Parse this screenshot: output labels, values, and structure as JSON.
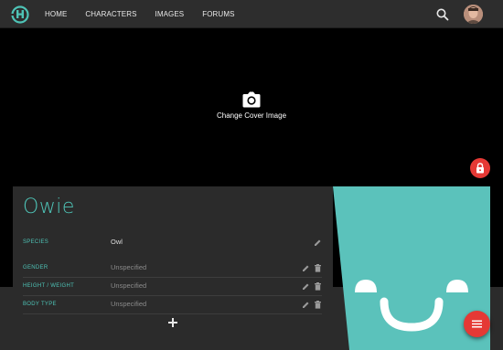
{
  "nav": {
    "items": [
      {
        "label": "HOME"
      },
      {
        "label": "CHARACTERS"
      },
      {
        "label": "IMAGES"
      },
      {
        "label": "FORUMS"
      }
    ],
    "logo_icon": "toyhouse-logo-icon",
    "search_icon": "search-icon"
  },
  "cover": {
    "change_label": "Change Cover Image",
    "camera_icon": "camera-icon",
    "lock_icon": "lock-icon"
  },
  "profile": {
    "name": "Owie",
    "fields": [
      {
        "label": "SPECIES",
        "value": "Owl"
      },
      {
        "label": "GENDER",
        "value": "Unspecified"
      },
      {
        "label": "HEIGHT / WEIGHT",
        "value": "Unspecified"
      },
      {
        "label": "BODY TYPE",
        "value": "Unspecified"
      }
    ],
    "add_icon": "plus-icon"
  },
  "fab": {
    "icon": "menu-icon"
  },
  "colors": {
    "accent": "#4ec3b6",
    "danger": "#e53935",
    "panel": "#2b2b2b",
    "topbar": "#2d2d2d"
  }
}
